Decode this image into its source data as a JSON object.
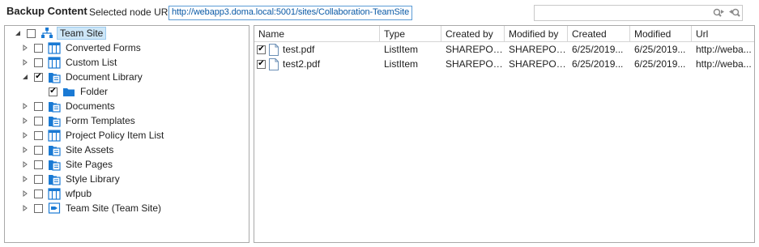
{
  "header": {
    "title": "Backup Content",
    "url_label": "Selected node URL:",
    "url_value": "http://webapp3.doma.local:5001/sites/Collaboration-TeamSite",
    "search_value": ""
  },
  "tree": {
    "root": {
      "label": "Team Site",
      "icon": "site-icon",
      "expander": "expanded",
      "checked": false
    },
    "items": [
      {
        "label": "Converted Forms",
        "icon": "list-icon",
        "checked": false,
        "expander": "collapsed"
      },
      {
        "label": "Custom List",
        "icon": "list-icon",
        "checked": false,
        "expander": "collapsed"
      },
      {
        "label": "Document Library",
        "icon": "library-icon",
        "checked": true,
        "expander": "expanded"
      },
      {
        "label": "Folder",
        "icon": "folder-icon",
        "checked": true,
        "expander": "none"
      },
      {
        "label": "Documents",
        "icon": "library-icon",
        "checked": false,
        "expander": "collapsed"
      },
      {
        "label": "Form Templates",
        "icon": "library-icon",
        "checked": false,
        "expander": "collapsed"
      },
      {
        "label": "Project Policy Item List",
        "icon": "list-icon",
        "checked": false,
        "expander": "collapsed"
      },
      {
        "label": "Site Assets",
        "icon": "library-icon",
        "checked": false,
        "expander": "collapsed"
      },
      {
        "label": "Site Pages",
        "icon": "library-icon",
        "checked": false,
        "expander": "collapsed"
      },
      {
        "label": "Style Library",
        "icon": "library-icon",
        "checked": false,
        "expander": "collapsed"
      },
      {
        "label": "wfpub",
        "icon": "list-icon",
        "checked": false,
        "expander": "collapsed"
      },
      {
        "label": "Team Site (Team Site)",
        "icon": "subsite-icon",
        "checked": false,
        "expander": "collapsed"
      }
    ]
  },
  "grid": {
    "columns": [
      "Name",
      "Type",
      "Created by",
      "Modified by",
      "Created",
      "Modified",
      "Url"
    ],
    "rows": [
      {
        "checked": true,
        "name": "test.pdf",
        "type": "ListItem",
        "created_by": "SHAREPOIN...",
        "modified_by": "SHAREPOIN...",
        "created": "6/25/2019...",
        "modified": "6/25/2019...",
        "url": "http://weba..."
      },
      {
        "checked": true,
        "name": "test2.pdf",
        "type": "ListItem",
        "created_by": "SHAREPOIN...",
        "modified_by": "SHAREPOIN...",
        "created": "6/25/2019...",
        "modified": "6/25/2019...",
        "url": "http://weba..."
      }
    ]
  },
  "colors": {
    "accent": "#1a7ad4",
    "selection": "#cde6f7",
    "url_text": "#0b5aa6"
  }
}
